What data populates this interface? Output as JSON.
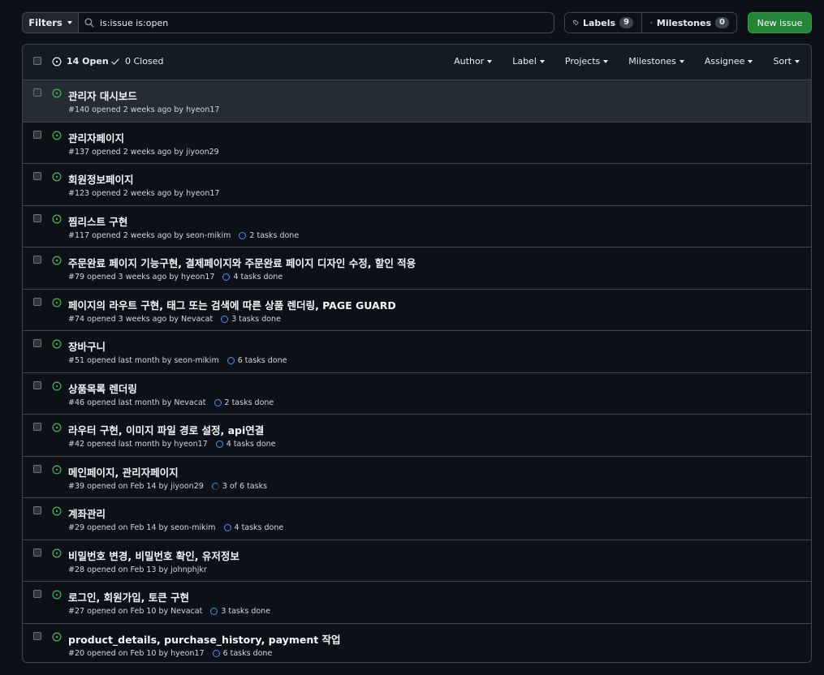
{
  "toolbar": {
    "filters_label": "Filters",
    "search_value": "is:issue is:open",
    "labels_label": "Labels",
    "labels_count": "9",
    "milestones_label": "Milestones",
    "milestones_count": "0",
    "new_issue_label": "New issue"
  },
  "header": {
    "open_label": "14 Open",
    "closed_label": "0 Closed",
    "menus": [
      "Author",
      "Label",
      "Projects",
      "Milestones",
      "Assignee",
      "Sort"
    ]
  },
  "issues": [
    {
      "title": "관리자 대시보드",
      "meta": "#140 opened 2 weeks ago by hyeon17",
      "tasks": ""
    },
    {
      "title": "관리자페이지",
      "meta": "#137 opened 2 weeks ago by jiyoon29",
      "tasks": ""
    },
    {
      "title": "회원정보페이지",
      "meta": "#123 opened 2 weeks ago by hyeon17",
      "tasks": ""
    },
    {
      "title": "찜리스트 구현",
      "meta": "#117 opened 2 weeks ago by seon-mikim",
      "tasks": "2 tasks done"
    },
    {
      "title": "주문완료 페이지 기능구현, 결제페이지와 주문완료 페이지 디자인 수정, 할인 적용",
      "meta": "#79 opened 3 weeks ago by hyeon17",
      "tasks": "4 tasks done"
    },
    {
      "title": "페이지의 라우트 구현, 태그 또는 검색에 따른 상품 렌더링, PAGE GUARD",
      "meta": "#74 opened 3 weeks ago by Nevacat",
      "tasks": "3 tasks done"
    },
    {
      "title": "장바구니",
      "meta": "#51 opened last month by seon-mikim",
      "tasks": "6 tasks done"
    },
    {
      "title": "상품목록 렌더링",
      "meta": "#46 opened last month by Nevacat",
      "tasks": "2 tasks done"
    },
    {
      "title": "라우터 구현, 이미지 파일 경로 설정, api연결",
      "meta": "#42 opened last month by hyeon17",
      "tasks": "4 tasks done"
    },
    {
      "title": "메인페이지, 관리자페이지",
      "meta": "#39 opened on Feb 14 by jiyoon29",
      "tasks": "3 of 6 tasks"
    },
    {
      "title": "계좌관리",
      "meta": "#29 opened on Feb 14 by seon-mikim",
      "tasks": "4 tasks done"
    },
    {
      "title": "비밀번호 변경, 비밀번호 확인, 유저정보",
      "meta": "#28 opened on Feb 13 by johnphjkr",
      "tasks": ""
    },
    {
      "title": "로그인, 회원가입, 토큰 구현",
      "meta": "#27 opened on Feb 10 by Nevacat",
      "tasks": "3 tasks done"
    },
    {
      "title": "product_details, purchase_history, payment 작업",
      "meta": "#20 opened on Feb 10 by hyeon17",
      "tasks": "6 tasks done"
    }
  ],
  "colors": {
    "background": "#0d1117",
    "border": "#3d444d",
    "open_green": "#3fb950",
    "progress_blue": "#4493f8",
    "new_issue_green": "#238636"
  },
  "icons": {
    "search": "search-icon",
    "tag": "tag-icon",
    "milestone": "milestone-icon",
    "issue_open": "issue-opened-icon",
    "check": "check-icon",
    "progress": "progress-ring-icon"
  }
}
